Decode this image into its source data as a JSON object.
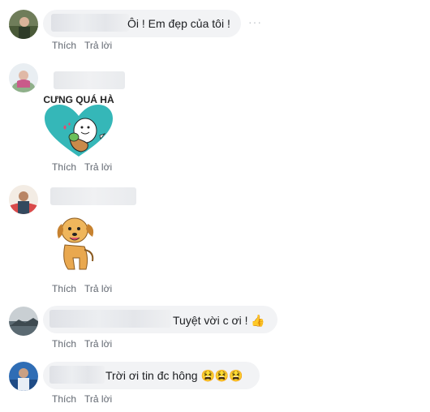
{
  "comments": [
    {
      "text": "Ôi ! Em đẹp của tôi !",
      "like_label": "Thích",
      "reply_label": "Trả lời",
      "more_label": "···"
    },
    {
      "text": "",
      "like_label": "Thích",
      "reply_label": "Trả lời",
      "sticker_text": "CƯNG QUÁ HÀ"
    },
    {
      "text": "",
      "like_label": "Thích",
      "reply_label": "Trả lời"
    },
    {
      "text": "Tuyệt vời c ơi ! 👍",
      "like_label": "Thích",
      "reply_label": "Trả lời"
    },
    {
      "text": "Trời ơi tin đc hông 😫😫😫",
      "like_label": "Thích",
      "reply_label": "Trả lời"
    }
  ],
  "colors": {
    "bubble": "#f2f3f5",
    "action_text": "#616770",
    "sticker_heart": "#35b7b8"
  }
}
